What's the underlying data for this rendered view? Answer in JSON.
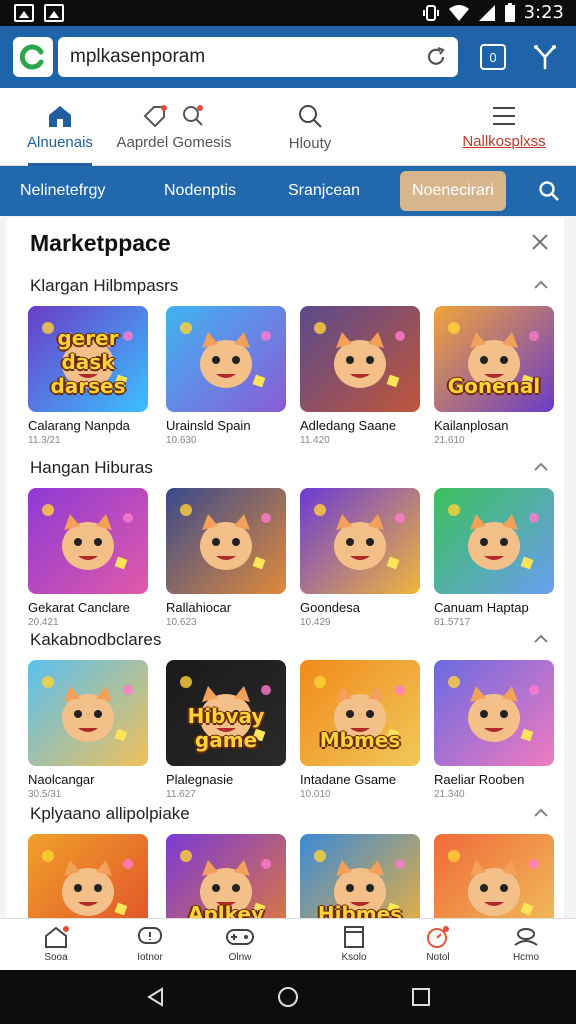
{
  "status_bar": {
    "time": "3:23"
  },
  "address_bar": {
    "url": "mplkasenporam",
    "tab_count": "0"
  },
  "top_nav": {
    "items": [
      {
        "label": "Alnuenais",
        "icon": "home-icon",
        "active": true
      },
      {
        "label": "Aaprdel Gomesis",
        "icon": "tag-icon"
      },
      {
        "label": "Hlouty",
        "icon": "search-icon"
      },
      {
        "label": "Nallkosplxss",
        "icon": "menu-icon"
      }
    ]
  },
  "category_bar": {
    "items": [
      "Nelinetefrgy",
      "Nodenptis",
      "Sranjcean",
      "Noenecirari"
    ],
    "selected_index": 3
  },
  "marketplace": {
    "title": "Marketppace",
    "sections": [
      {
        "title": "Klargan Hilbmpasrs",
        "tiles": [
          {
            "name": "Calarang Nanpda",
            "sub": "11.3/21",
            "art": "gerer dask darses",
            "bg": [
              "#6a3cc8",
              "#3ac0ff"
            ]
          },
          {
            "name": "Urainsld Spain",
            "sub": "10.630",
            "art": "",
            "bg": [
              "#3fb4f2",
              "#8b5bd6"
            ]
          },
          {
            "name": "Adledang Saane",
            "sub": "11.420",
            "art": "",
            "bg": [
              "#5a4a8c",
              "#c0563a"
            ]
          },
          {
            "name": "Kailanplosan",
            "sub": "21.610",
            "art": "Gonenal",
            "bg": [
              "#f1a43a",
              "#6a3cc8"
            ]
          }
        ]
      },
      {
        "title": "Hangan Hiburas",
        "tiles": [
          {
            "name": "Gekarat Canclare",
            "sub": "20.421",
            "art": "",
            "bg": [
              "#8e3ad6",
              "#e05aa8"
            ]
          },
          {
            "name": "Rallahiocar",
            "sub": "10.623",
            "art": "",
            "bg": [
              "#3a4a8c",
              "#e08a3a"
            ]
          },
          {
            "name": "Goondesa",
            "sub": "10.429",
            "art": "",
            "bg": [
              "#6b3ad6",
              "#f0b63a"
            ]
          },
          {
            "name": "Canuam Haptap",
            "sub": "81.5717",
            "art": "",
            "bg": [
              "#3ac05a",
              "#6a9ef0"
            ]
          }
        ]
      },
      {
        "title": "Kakabnodbclares",
        "tiles": [
          {
            "name": "Naolcangar",
            "sub": "30.5/31",
            "art": "",
            "bg": [
              "#5ac0f0",
              "#f0c05a"
            ]
          },
          {
            "name": "Plalegnasie",
            "sub": "11.627",
            "art": "Hibvay game",
            "bg": [
              "#1a1a1a",
              "#2a2a2a"
            ]
          },
          {
            "name": "Intadane Gsame",
            "sub": "10.010",
            "art": "Mbmes",
            "bg": [
              "#f08a1a",
              "#f0c85a"
            ]
          },
          {
            "name": "Raeliar Rooben",
            "sub": "21.340",
            "art": "",
            "bg": [
              "#6a6ae0",
              "#f07ac0"
            ]
          }
        ]
      },
      {
        "title": "Kplyaano allipolpiake",
        "tiles": [
          {
            "name": "",
            "sub": "",
            "art": "",
            "bg": [
              "#f0a02a",
              "#e0502a"
            ]
          },
          {
            "name": "",
            "sub": "",
            "art": "Aplkey",
            "bg": [
              "#7a3ad6",
              "#e07a3a"
            ]
          },
          {
            "name": "",
            "sub": "",
            "art": "Hibmes",
            "bg": [
              "#3a8ad6",
              "#f0b03a"
            ]
          },
          {
            "name": "",
            "sub": "",
            "art": "",
            "bg": [
              "#f06a3a",
              "#f0c05a"
            ]
          }
        ]
      }
    ]
  },
  "bottom_nav": {
    "items": [
      {
        "label": "Sooa",
        "icon": "home-icon"
      },
      {
        "label": "Iotnor",
        "icon": "chat-icon"
      },
      {
        "label": "Olnw",
        "icon": "gamepad-icon"
      },
      {
        "label": "Ksolo",
        "icon": "book-icon"
      },
      {
        "label": "Notol",
        "icon": "notification-icon"
      },
      {
        "label": "Hcmo",
        "icon": "profile-icon"
      }
    ]
  },
  "colors": {
    "brand_blue": "#1f63a8",
    "category_blue": "#2168ad",
    "selected_tan": "#d7b68e",
    "accent_red": "#c0392b"
  }
}
